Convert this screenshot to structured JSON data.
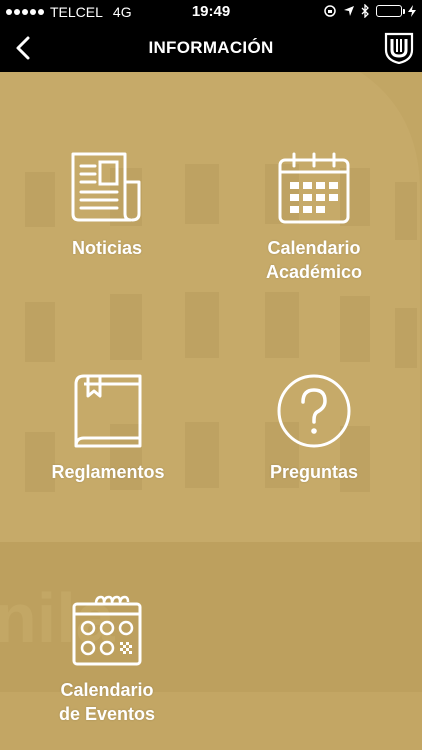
{
  "status_bar": {
    "carrier": "TELCEL",
    "network": "4G",
    "time": "19:49"
  },
  "nav": {
    "title": "INFORMACIÓN",
    "back_icon": "chevron-left-icon",
    "logo_icon": "university-shield-logo"
  },
  "tiles": [
    {
      "label": "Noticias",
      "icon": "newspaper-icon"
    },
    {
      "label": "Calendario\nAcadémico",
      "icon": "calendar-icon"
    },
    {
      "label": "Reglamentos",
      "icon": "book-icon"
    },
    {
      "label": "Preguntas",
      "icon": "question-icon"
    },
    {
      "label": "Calendario\nde Eventos",
      "icon": "event-calendar-icon"
    }
  ],
  "colors": {
    "bar_background": "#000000",
    "content_tint": "#c4a866",
    "battery": "#4cd964",
    "foreground": "#ffffff"
  }
}
